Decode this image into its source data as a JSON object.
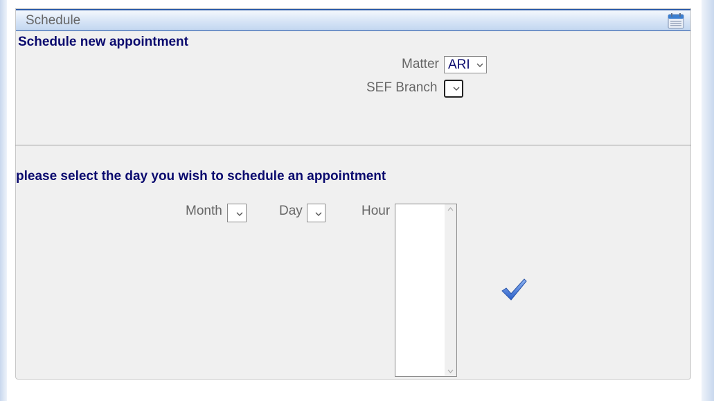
{
  "panel": {
    "title": "Schedule",
    "header_icon": "calendar-icon"
  },
  "new_appointment": {
    "heading": "Schedule new appointment",
    "matter": {
      "label": "Matter",
      "selected": "ARI"
    },
    "branch": {
      "label": "SEF Branch",
      "selected": ""
    }
  },
  "day_selection": {
    "heading": "please select the day you wish to schedule an appointment",
    "month": {
      "label": "Month",
      "selected": ""
    },
    "day": {
      "label": "Day",
      "selected": ""
    },
    "hour": {
      "label": "Hour",
      "options": []
    },
    "confirm_icon": "checkmark-icon"
  },
  "colors": {
    "header_border": "#2c5ba8",
    "heading_text": "#0a0a6e",
    "label_text": "#666666",
    "panel_bg": "#f0f0f0",
    "confirm": "#3a6fd6"
  }
}
